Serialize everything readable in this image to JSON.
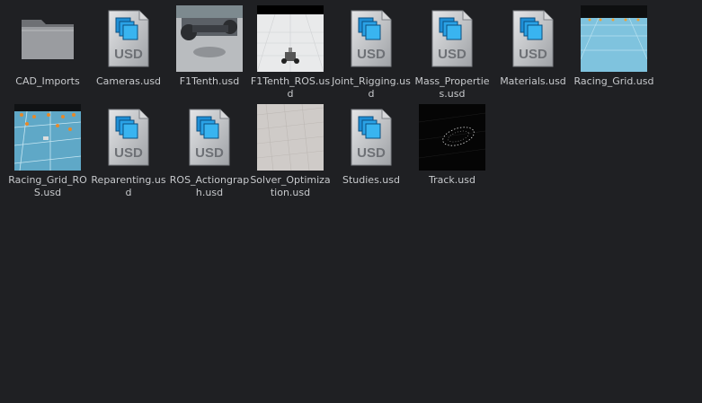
{
  "colors": {
    "background": "#1f2023",
    "label_text": "#c7c9cc",
    "usd_doc_body": "#bfc1c4",
    "usd_accent": "#1f8fd6"
  },
  "items": [
    {
      "label": "CAD_Imports",
      "icon": "folder-icon",
      "kind": "folder"
    },
    {
      "label": "Cameras.usd",
      "icon": "usd-file-icon",
      "kind": "usd"
    },
    {
      "label": "F1Tenth.usd",
      "icon": "car-thumbnail",
      "kind": "thumb-car"
    },
    {
      "label": "F1Tenth_ROS.usd",
      "icon": "robot-thumbnail",
      "kind": "thumb-robot"
    },
    {
      "label": "Joint_Rigging.usd",
      "icon": "usd-file-icon",
      "kind": "usd"
    },
    {
      "label": "Mass_Properties.usd",
      "icon": "usd-file-icon",
      "kind": "usd"
    },
    {
      "label": "Materials.usd",
      "icon": "usd-file-icon",
      "kind": "usd"
    },
    {
      "label": "Racing_Grid.usd",
      "icon": "racing-grid-thumbnail",
      "kind": "thumb-grid"
    },
    {
      "label": "Racing_Grid_ROS.usd",
      "icon": "racing-grid-ros-thumbnail",
      "kind": "thumb-grid-ros"
    },
    {
      "label": "Reparenting.usd",
      "icon": "usd-file-icon",
      "kind": "usd"
    },
    {
      "label": "ROS_Actiongraph.usd",
      "icon": "usd-file-icon",
      "kind": "usd"
    },
    {
      "label": "Solver_Optimization.usd",
      "icon": "floor-grid-thumbnail",
      "kind": "thumb-floor"
    },
    {
      "label": "Studies.usd",
      "icon": "usd-file-icon",
      "kind": "usd"
    },
    {
      "label": "Track.usd",
      "icon": "track-thumbnail",
      "kind": "thumb-track"
    }
  ]
}
